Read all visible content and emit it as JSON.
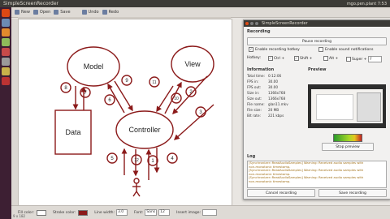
{
  "top_panel": {
    "title": "SimpleScreenRecorder",
    "tray": "mgo.pen.plant 7:53"
  },
  "toolbar": {
    "new_label": "New",
    "open_label": "Open",
    "save_label": "Save",
    "undo_label": "Undo",
    "redo_label": "Redo"
  },
  "diagram": {
    "model": "Model",
    "view": "View",
    "data": "Data",
    "controller": "Controller",
    "numbers": [
      "1",
      "2",
      "3",
      "4",
      "5",
      "6",
      "7",
      "8",
      "9",
      "10",
      "11",
      "12"
    ]
  },
  "bottom_bar": {
    "fill_color_label": "Fill color:",
    "stroke_color_label": "Stroke color:",
    "line_width_label": "Line width:",
    "line_width_value": "3.0",
    "font_label": "Font:",
    "font_value": "Sans",
    "font_size": "12",
    "insert_image_label": "Insert image:",
    "coords": "9 x 182"
  },
  "ssr": {
    "title": "SimpleScreenRecorder",
    "recording_section": "Recording",
    "pause_button": "Pause recording",
    "enable_hotkey": "Enable recording hotkey",
    "enable_sound": "Enable sound notifications",
    "hotkey_label": "Hotkey:",
    "ctrl": "Ctrl +",
    "shift": "Shift +",
    "alt": "Alt +",
    "super": "Super +",
    "key": "F",
    "information_section": "Information",
    "preview_section": "Preview",
    "info": [
      {
        "k": "Total time:",
        "v": "0:12:06"
      },
      {
        "k": "FPS in:",
        "v": "30.00"
      },
      {
        "k": "FPS out:",
        "v": "30.00"
      },
      {
        "k": "Size in:",
        "v": "1366x768"
      },
      {
        "k": "Size out:",
        "v": "1366x768"
      },
      {
        "k": "File name:",
        "v": "glan11.mkv"
      },
      {
        "k": "File size:",
        "v": "20 MB"
      },
      {
        "k": "Bit rate:",
        "v": "221 kbps"
      }
    ],
    "stop_preview": "Stop preview",
    "log_section": "Log",
    "log_lines": [
      "[Synchronizer::ReadAudioSamples] Warning: Received audio samples with",
      "non-monotonic timestamp.",
      "[Synchronizer::ReadAudioSamples] Warning: Received audio samples with",
      "non-monotonic timestamp.",
      "[Synchronizer::ReadAudioSamples] Warning: Received audio samples with",
      "non-monotonic timestamp."
    ],
    "cancel_button": "Cancel recording",
    "save_button": "Save recording"
  },
  "colors": {
    "accent_red": "#8b1a1a",
    "ubuntu_topbar": "#3c3b37",
    "launcher": "#3d1f33"
  }
}
